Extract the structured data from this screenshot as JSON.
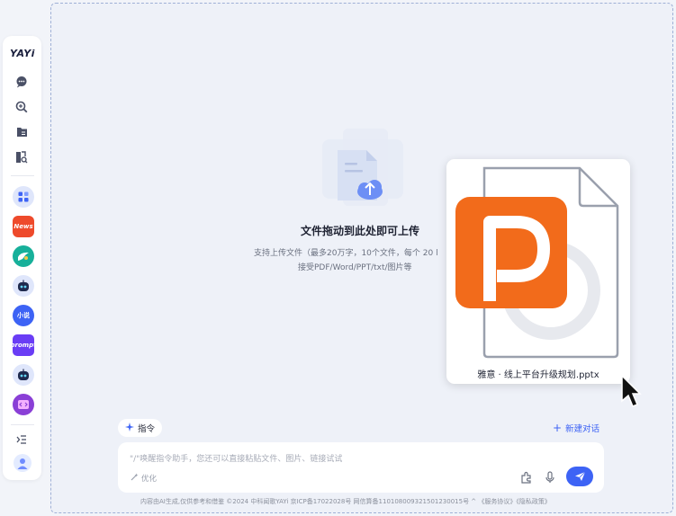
{
  "sidebar": {
    "logo": "YAYi",
    "apps": [
      {
        "icon": "apps-grid-icon",
        "text": ""
      },
      {
        "icon": "news-app-icon",
        "text": "News"
      },
      {
        "icon": "chat-app-icon",
        "text": ""
      },
      {
        "icon": "robot-app-icon",
        "text": ""
      },
      {
        "icon": "novel-app-icon",
        "text": "小说"
      },
      {
        "icon": "prompt-app-icon",
        "text": "prompt"
      },
      {
        "icon": "robot-app-icon-2",
        "text": ""
      },
      {
        "icon": "code-app-icon",
        "text": ""
      }
    ],
    "colors": {
      "accent": "#3d63f5"
    }
  },
  "upload": {
    "title": "文件拖动到此处即可上传",
    "hint_line1": "支持上传文件（最多20万字，10个文件，每个 20 l",
    "hint_line2": "接受PDF/Word/PPT/txt/图片等"
  },
  "dragged_file": {
    "name": "雅意 · 线上平台升级规划.pptx",
    "icon": "powerpoint-file-icon"
  },
  "toolbar": {
    "command_label": "指令",
    "new_chat_label": "新建对话"
  },
  "input": {
    "placeholder": "\"/\"唤醒指令助手，您还可以直接粘贴文件、图片、链接试试",
    "optimize_label": "优化"
  },
  "footer": {
    "text": "内容由AI生成,仅供参考和借鉴 ©2024 中科闻歌YAYi  京ICP备17022028号  网信算备110108009321501230015号 ^   《服务协议》《隐私政策》"
  }
}
